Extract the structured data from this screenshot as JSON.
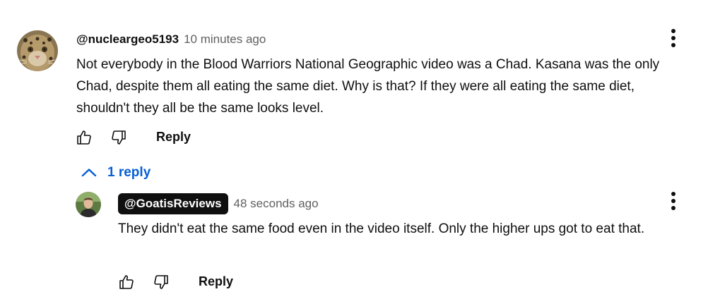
{
  "colors": {
    "text": "#0f0f0f",
    "secondary": "#606060",
    "link": "#065fd4",
    "author_chip_bg": "#0f0f0f"
  },
  "comment": {
    "author": "@nucleargeo5193",
    "timestamp": "10 minutes ago",
    "text": "Not everybody in the Blood Warriors National Geographic video was a Chad. Kasana was the only Chad, despite them all eating the same diet. Why is that? If they were all eating the same diet, shouldn't they all be the same looks level.",
    "avatar_icon": "leopard-avatar",
    "like_icon": "thumbs-up-icon",
    "dislike_icon": "thumbs-down-icon",
    "reply_label": "Reply",
    "menu_icon": "more-vert-icon"
  },
  "replies_toggle": {
    "icon": "chevron-up-icon",
    "label": "1 reply"
  },
  "reply": {
    "author": "@GoatisReviews",
    "timestamp": "48 seconds ago",
    "text": "They didn't eat the same food even in the video itself. Only the higher ups got to eat that.",
    "avatar_icon": "person-avatar",
    "like_icon": "thumbs-up-icon",
    "dislike_icon": "thumbs-down-icon",
    "reply_label": "Reply",
    "menu_icon": "more-vert-icon"
  }
}
